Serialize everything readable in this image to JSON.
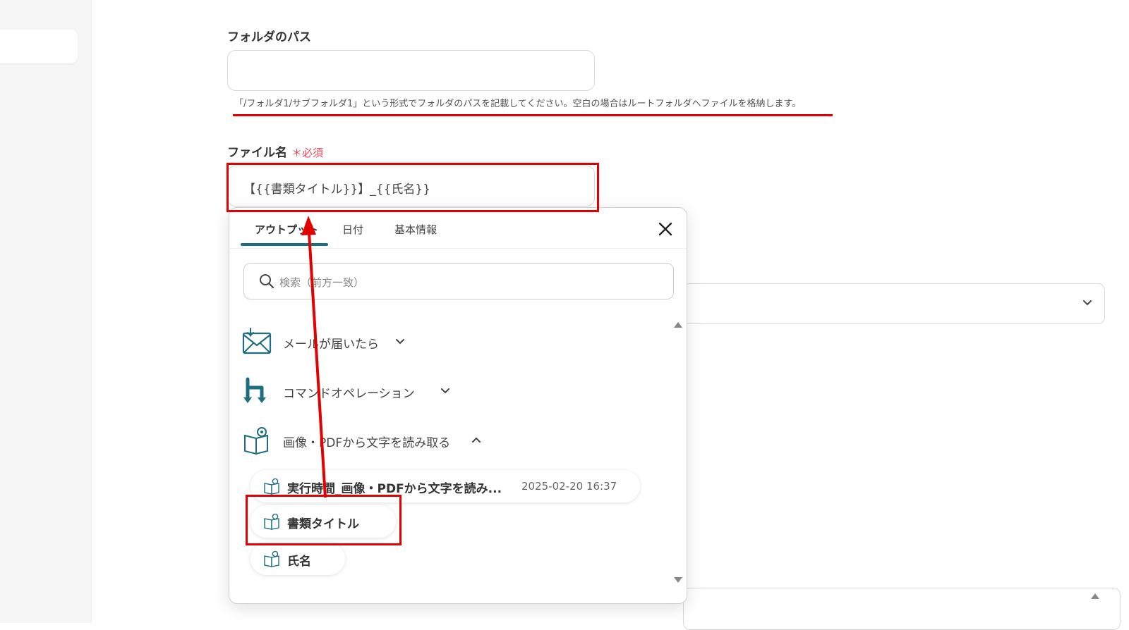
{
  "folder_path": {
    "label": "フォルダのパス",
    "value": "",
    "help": "「/フォルダ1/サブフォルダ1」という形式でフォルダのパスを記載してください。空白の場合はルートフォルダへファイルを格納します。"
  },
  "file_name": {
    "label": "ファイル名",
    "required": "＊必須",
    "value": "【{{書類タイトル}}】_{{氏名}}"
  },
  "popup": {
    "tabs": [
      {
        "label": "アウトプット"
      },
      {
        "label": "日付"
      },
      {
        "label": "基本情報"
      }
    ],
    "active_tab": "アウトプット",
    "search_placeholder": "検索（前方一致）",
    "groups": [
      {
        "label": "メールが届いたら",
        "icon": "mail-icon",
        "expanded": false
      },
      {
        "label": "コマンドオペレーション",
        "icon": "command-operation-icon",
        "expanded": false
      },
      {
        "label": "画像・PDFから文字を読み取る",
        "icon": "ocr-book-icon",
        "expanded": true
      }
    ],
    "items": [
      {
        "label": "実行時間_画像・PDFから文字を読み...",
        "value": "2025-02-20 16:37"
      },
      {
        "label": "書類タイトル",
        "value": ""
      },
      {
        "label": "氏名",
        "value": ""
      }
    ]
  },
  "colors": {
    "accent": "#1e6e82",
    "annotation": "#e30000",
    "required": "#e8485a"
  }
}
